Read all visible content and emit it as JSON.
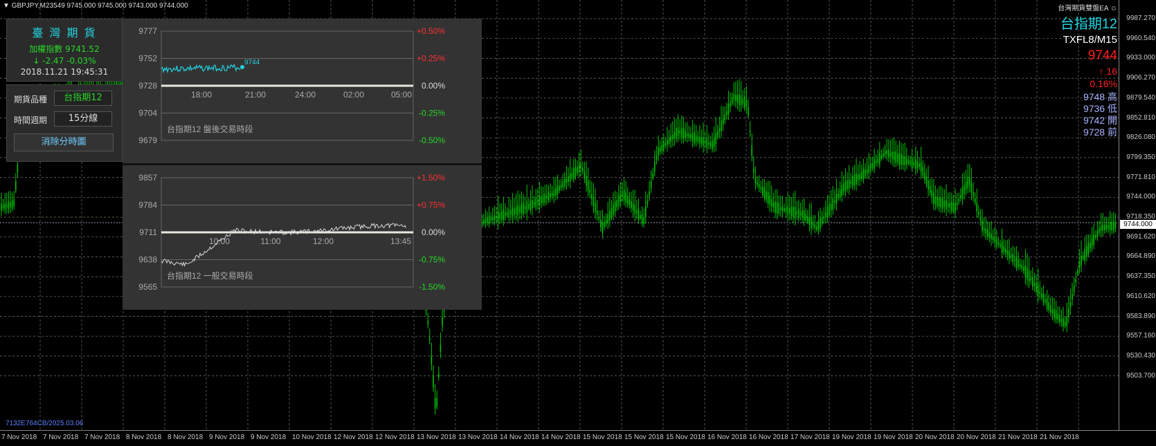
{
  "header": {
    "symbol_line": "GBPJPY,M23549  9745.000 9745.000 9743.000 9744.000",
    "ea_name": "台灣期貨雙盤EA"
  },
  "info": {
    "product": "台指期12",
    "symbol": "TXFL8/M15",
    "price": "9744",
    "change": "↑ 16",
    "change_pct": "0.16%",
    "high": "9748 高",
    "low": "9736 低",
    "open": "9742 開",
    "prev": "9728 前"
  },
  "left_panel": {
    "title": "臺 灣 期 貨",
    "index_label": "加權指數  9741.52",
    "index_change": "↓  -2.47  -0.03%",
    "timestamp": "2018.11.21 19:45:31",
    "product_label": "期貨品種",
    "product_value": "台指期12",
    "period_label": "時間週期",
    "period_value": "15分線",
    "clear_button": "消除分時圖"
  },
  "mini_after": {
    "caption": "台指期12  盤後交易時段",
    "y_labels": [
      "9777",
      "9752",
      "9728",
      "9704",
      "9679"
    ],
    "pct_labels": [
      "+0.50%",
      "+0.25%",
      "0.00%",
      "-0.25%",
      "-0.50%"
    ],
    "x_labels": [
      "18:00",
      "21:00",
      "24:00",
      "02:00",
      "05:00"
    ],
    "last_label": "9744"
  },
  "mini_day": {
    "caption": "台指期12  一般交易時段",
    "y_labels": [
      "9857",
      "9784",
      "9711",
      "9638",
      "9565"
    ],
    "pct_labels": [
      "+1.50%",
      "+0.75%",
      "0.00%",
      "-0.75%",
      "-1.50%"
    ],
    "x_labels": [
      "10:00",
      "11:00",
      "12:00",
      "13:45"
    ]
  },
  "price_axis": [
    "9987.270",
    "9960.540",
    "9933.000",
    "9906.270",
    "9879.540",
    "9852.810",
    "9826.080",
    "9799.350",
    "9771.810",
    "9744.000",
    "9718.350",
    "9691.620",
    "9664.890",
    "9637.350",
    "9610.620",
    "9583.890",
    "9557.160",
    "9530.430",
    "9503.700"
  ],
  "current_price_tag": "9744.000",
  "date_axis": [
    "7 Nov 2018",
    "7 Nov 2018",
    "7 Nov 2018",
    "8 Nov 2018",
    "8 Nov 2018",
    "9 Nov 2018",
    "9 Nov 2018",
    "10 Nov 2018",
    "12 Nov 2018",
    "12 Nov 2018",
    "13 Nov 2018",
    "13 Nov 2018",
    "14 Nov 2018",
    "14 Nov 2018",
    "15 Nov 2018",
    "15 Nov 2018",
    "15 Nov 2018",
    "16 Nov 2018",
    "16 Nov 2018",
    "17 Nov 2018",
    "19 Nov 2018",
    "19 Nov 2018",
    "20 Nov 2018",
    "20 Nov 2018",
    "21 Nov 2018",
    "21 Nov 2018"
  ],
  "watermark": "7132E764CB/2025.03.06",
  "colors": {
    "candle": "#00c800",
    "cyan": "#22d3e0",
    "red": "#ff2020",
    "green_text": "#28d728",
    "info_blue": "#aab4ff"
  }
}
